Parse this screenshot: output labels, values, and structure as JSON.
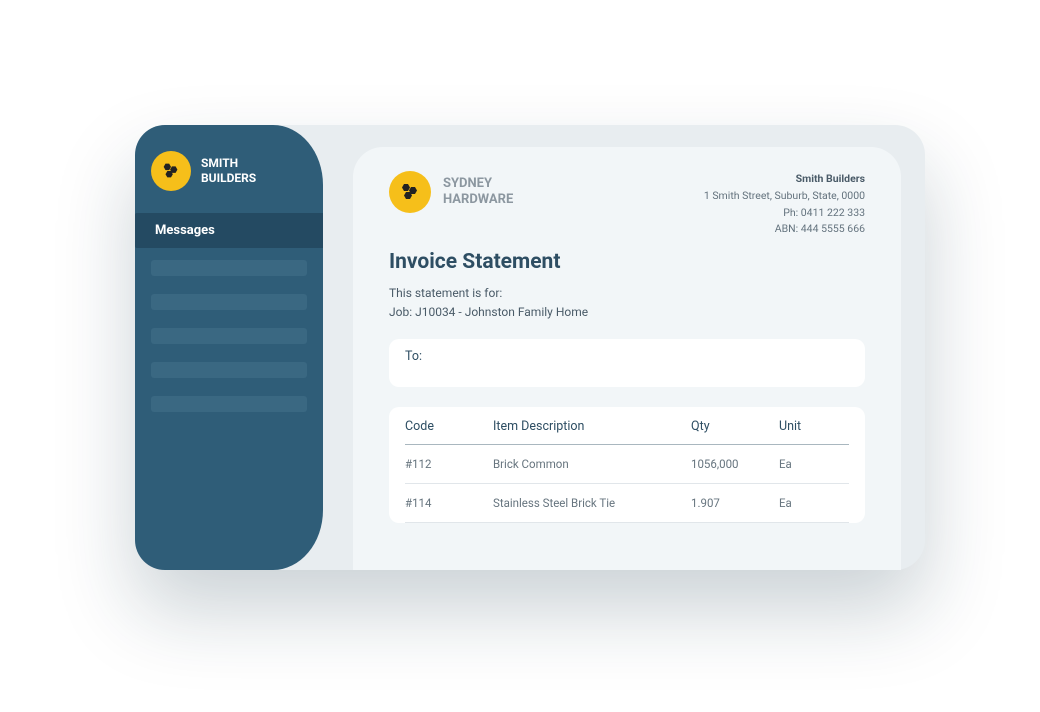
{
  "sidebar": {
    "company": "SMITH\nBUILDERS",
    "active_item": "Messages"
  },
  "doc": {
    "supplier_name": "SYDNEY\nHARDWARE",
    "bill_to": {
      "name": "Smith Builders",
      "address": "1 Smith Street, Suburb, State, 0000",
      "phone": "Ph: 0411 222 333",
      "abn": "ABN: 444 5555 666"
    },
    "title": "Invoice Statement",
    "meta_line1": "This statement is for:",
    "meta_line2": "Job: J10034 - Johnston Family Home",
    "to_label": "To:",
    "table": {
      "headers": {
        "code": "Code",
        "desc": "Item Description",
        "qty": "Qty",
        "unit": "Unit"
      },
      "rows": [
        {
          "code": "#112",
          "desc": "Brick Common",
          "qty": "1056,000",
          "unit": "Ea"
        },
        {
          "code": "#114",
          "desc": "Stainless Steel Brick Tie",
          "qty": "1.907",
          "unit": "Ea"
        }
      ]
    }
  }
}
